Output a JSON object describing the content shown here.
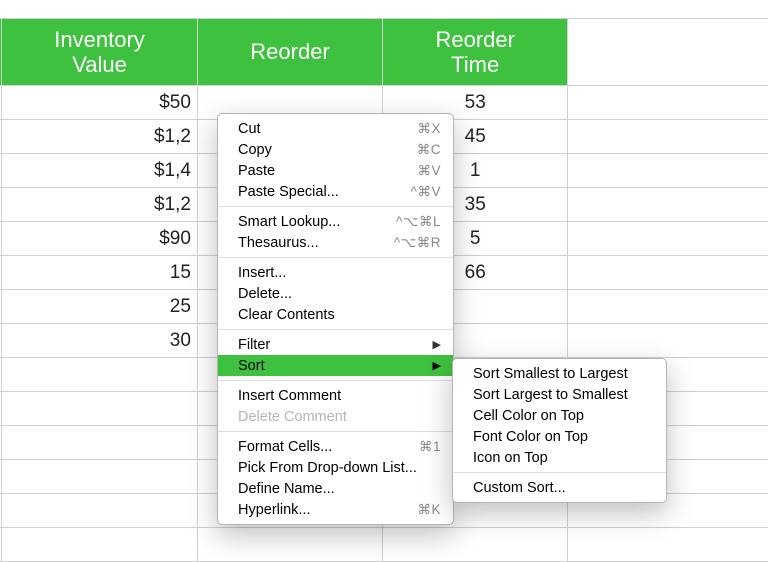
{
  "headers": {
    "a": "Inventory\nValue",
    "b": "Reorder",
    "c": "Reorder\nTime"
  },
  "rows": [
    {
      "a": "$50",
      "c": "53"
    },
    {
      "a": "$1,2",
      "c": "45"
    },
    {
      "a": "$1,4",
      "c": "1"
    },
    {
      "a": "$1,2",
      "c": "35"
    },
    {
      "a": "$90",
      "c": "5"
    },
    {
      "a": "15",
      "c": "66"
    },
    {
      "a": "25",
      "c": ""
    },
    {
      "a": "30",
      "c": ""
    }
  ],
  "menu": {
    "cut": "Cut",
    "cut_k": "⌘X",
    "copy": "Copy",
    "copy_k": "⌘C",
    "paste": "Paste",
    "paste_k": "⌘V",
    "paste_special": "Paste Special...",
    "paste_special_k": "^⌘V",
    "smart_lookup": "Smart Lookup...",
    "smart_lookup_k": "^⌥⌘L",
    "thesaurus": "Thesaurus...",
    "thesaurus_k": "^⌥⌘R",
    "insert": "Insert...",
    "delete": "Delete...",
    "clear": "Clear Contents",
    "filter": "Filter",
    "sort": "Sort",
    "insert_comment": "Insert Comment",
    "delete_comment": "Delete Comment",
    "format_cells": "Format Cells...",
    "format_cells_k": "⌘1",
    "pick_list": "Pick From Drop-down List...",
    "define_name": "Define Name...",
    "hyperlink": "Hyperlink...",
    "hyperlink_k": "⌘K"
  },
  "submenu": {
    "s2l": "Sort Smallest to Largest",
    "l2s": "Sort Largest to Smallest",
    "cell_color": "Cell Color on Top",
    "font_color": "Font Color on Top",
    "icon_top": "Icon on Top",
    "custom": "Custom Sort..."
  }
}
